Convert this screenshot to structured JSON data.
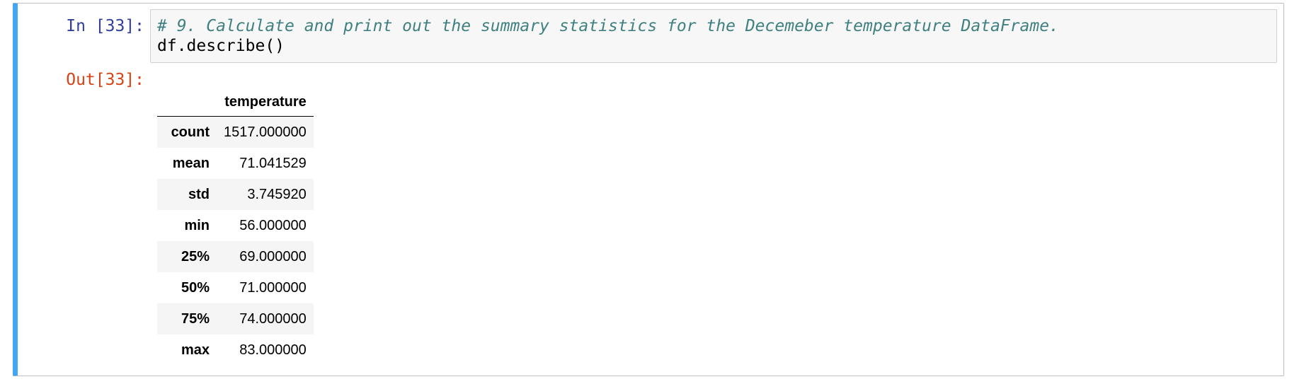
{
  "cell": {
    "in_prompt": "In [33]:",
    "out_prompt": "Out[33]:",
    "code": {
      "line1": "# 9. Calculate and print out the summary statistics for the Decemeber temperature DataFrame.",
      "line2": "df.describe()"
    }
  },
  "output": {
    "columns": [
      "",
      "temperature"
    ],
    "rows": [
      {
        "label": "count",
        "value": "1517.000000"
      },
      {
        "label": "mean",
        "value": "71.041529"
      },
      {
        "label": "std",
        "value": "3.745920"
      },
      {
        "label": "min",
        "value": "56.000000"
      },
      {
        "label": "25%",
        "value": "69.000000"
      },
      {
        "label": "50%",
        "value": "71.000000"
      },
      {
        "label": "75%",
        "value": "74.000000"
      },
      {
        "label": "max",
        "value": "83.000000"
      }
    ]
  },
  "colors": {
    "selected_cell_bar": "#42a5f5",
    "in_prompt": "#303f9f",
    "out_prompt": "#d84315",
    "comment": "#408080"
  }
}
